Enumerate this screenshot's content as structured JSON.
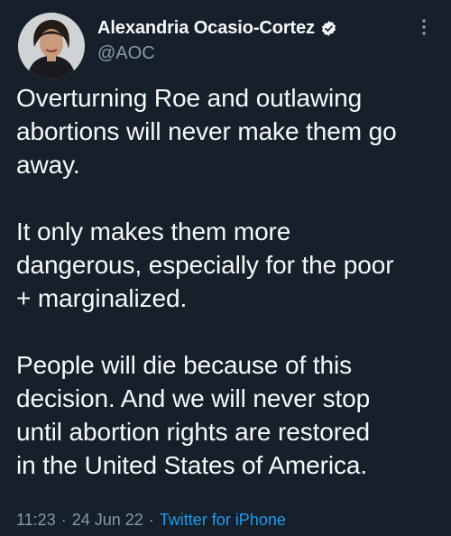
{
  "author": {
    "display_name": "Alexandria Ocasio-Cortez",
    "handle": "@AOC",
    "verified": true
  },
  "tweet": {
    "paragraphs": [
      "Overturning Roe and outlawing\nabortions will never make them go\naway.",
      "It only makes them more\ndangerous, especially for the poor\n+ marginalized.",
      "People will die because of this\ndecision. And we will never stop\nuntil abortion rights are restored\nin the United States of America."
    ]
  },
  "meta": {
    "time": "11:23",
    "separator": "·",
    "date": "24 Jun 22",
    "source": "Twitter for iPhone"
  },
  "icons": {
    "verified": "verified-badge-icon",
    "more": "more-vertical-icon"
  },
  "colors": {
    "background": "#15202b",
    "text": "#f7f9f9",
    "secondary": "#8b98a5",
    "accent": "#1d9bf0"
  }
}
